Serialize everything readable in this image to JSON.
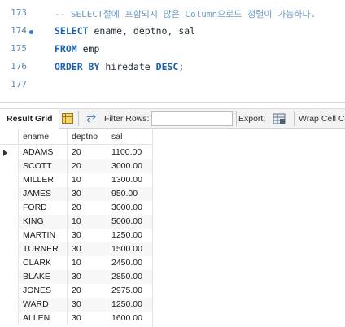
{
  "editor": {
    "lines": [
      {
        "number": "173",
        "comment": "-- SELECT절에 포함되지 않은 Column으로도 정렬이 가능하다."
      },
      {
        "number": "174",
        "kw1": "SELECT",
        "rest1": " ename, deptno, sal"
      },
      {
        "number": "175",
        "kw1": "FROM",
        "rest1": " emp"
      },
      {
        "number": "176",
        "kw1": "ORDER BY",
        "rest1": " hiredate ",
        "kw2": "DESC",
        "rest2": ";"
      },
      {
        "number": "177"
      }
    ]
  },
  "toolbar": {
    "result_grid": "Result Grid",
    "filter_rows": "Filter Rows:",
    "filter_value": "",
    "export": "Export:",
    "wrap_cell": "Wrap Cell Co"
  },
  "grid": {
    "columns": [
      "ename",
      "deptno",
      "sal"
    ],
    "rows": [
      [
        "ADAMS",
        "20",
        "1100.00"
      ],
      [
        "SCOTT",
        "20",
        "3000.00"
      ],
      [
        "MILLER",
        "10",
        "1300.00"
      ],
      [
        "JAMES",
        "30",
        "950.00"
      ],
      [
        "FORD",
        "20",
        "3000.00"
      ],
      [
        "KING",
        "10",
        "5000.00"
      ],
      [
        "MARTIN",
        "30",
        "1250.00"
      ],
      [
        "TURNER",
        "30",
        "1500.00"
      ],
      [
        "CLARK",
        "10",
        "2450.00"
      ],
      [
        "BLAKE",
        "30",
        "2850.00"
      ],
      [
        "JONES",
        "20",
        "2975.00"
      ],
      [
        "WARD",
        "30",
        "1250.00"
      ],
      [
        "ALLEN",
        "30",
        "1600.00"
      ]
    ]
  },
  "icons": {
    "statement_marker": "blue-dot-icon",
    "grid_view": "grid-icon",
    "refresh": "refresh-icon",
    "export": "export-icon",
    "current_row": "current-row-arrow-icon"
  }
}
